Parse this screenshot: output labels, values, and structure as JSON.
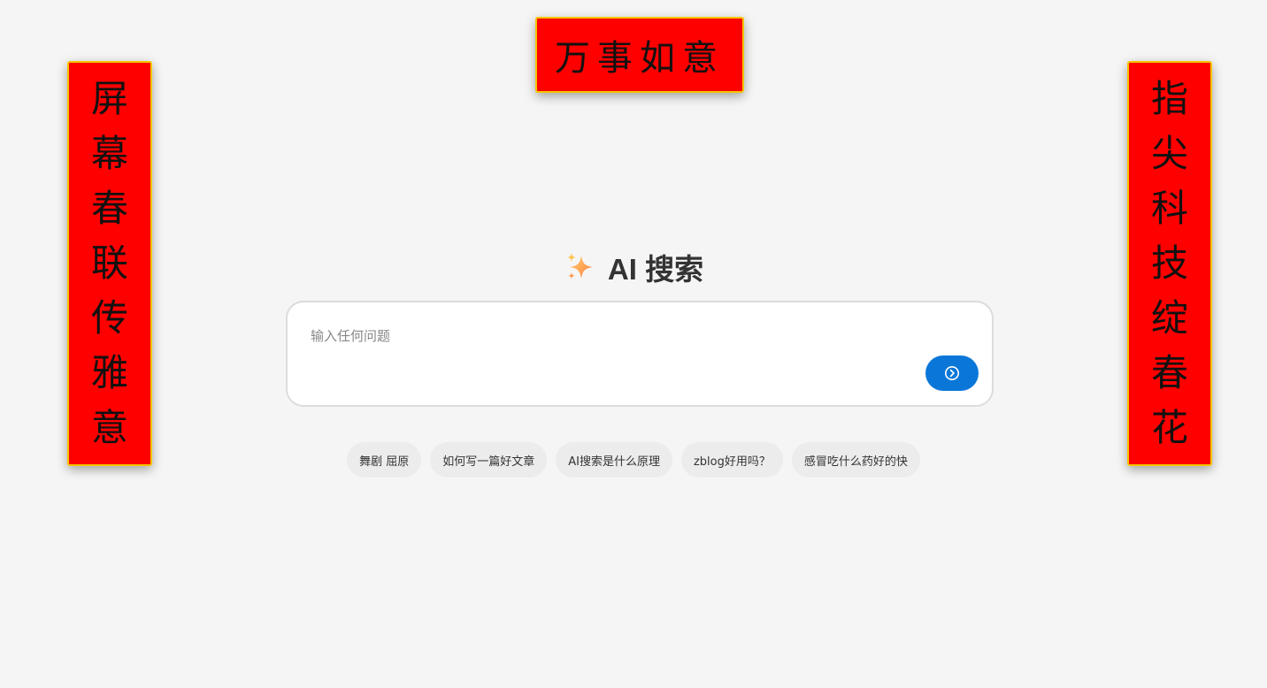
{
  "couplets": {
    "top": "万事如意",
    "left": [
      "屏",
      "幕",
      "春",
      "联",
      "传",
      "雅",
      "意"
    ],
    "right": [
      "指",
      "尖",
      "科",
      "技",
      "绽",
      "春",
      "花"
    ]
  },
  "heading": {
    "icon": "sparkle-icon",
    "title": "AI 搜索"
  },
  "search": {
    "placeholder": "输入任何问题",
    "value": "",
    "send_icon": "arrow-right-circle-icon"
  },
  "suggestions": [
    "舞剧 屈原",
    "如何写一篇好文章",
    "AI搜索是什么原理",
    "zblog好用吗？",
    "感冒吃什么药好的快"
  ],
  "colors": {
    "background": "#f5f5f5",
    "couplet_red": "#ff0000",
    "couplet_border": "#f5c400",
    "send_button": "#0a77d8"
  }
}
